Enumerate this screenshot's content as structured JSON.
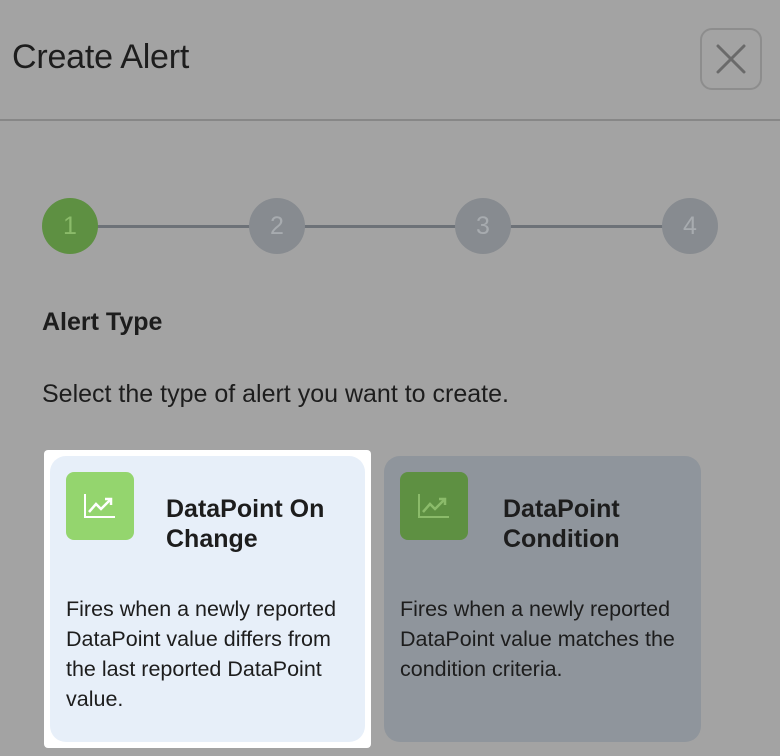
{
  "dialog": {
    "title": "Create Alert",
    "close_icon": "close-icon"
  },
  "stepper": {
    "steps": [
      {
        "label": "1",
        "active": true
      },
      {
        "label": "2",
        "active": false
      },
      {
        "label": "3",
        "active": false
      },
      {
        "label": "4",
        "active": false
      }
    ]
  },
  "section": {
    "title": "Alert Type",
    "description": "Select the type of alert you want to create."
  },
  "options": [
    {
      "title": "DataPoint On Change",
      "description": "Fires when a newly reported DataPoint value differs from the last reported DataPoint value.",
      "icon": "line-chart-icon",
      "selected": true
    },
    {
      "title": "DataPoint Condition",
      "description": "Fires when a newly reported DataPoint value matches the condition criteria.",
      "icon": "line-chart-icon",
      "selected": false
    }
  ],
  "colors": {
    "active_step": "#5e9042",
    "inactive_step": "#878b90",
    "selected_card": "#e7eff9",
    "selected_icon_bg": "#94d56e",
    "other_icon_bg": "#5e9042"
  }
}
